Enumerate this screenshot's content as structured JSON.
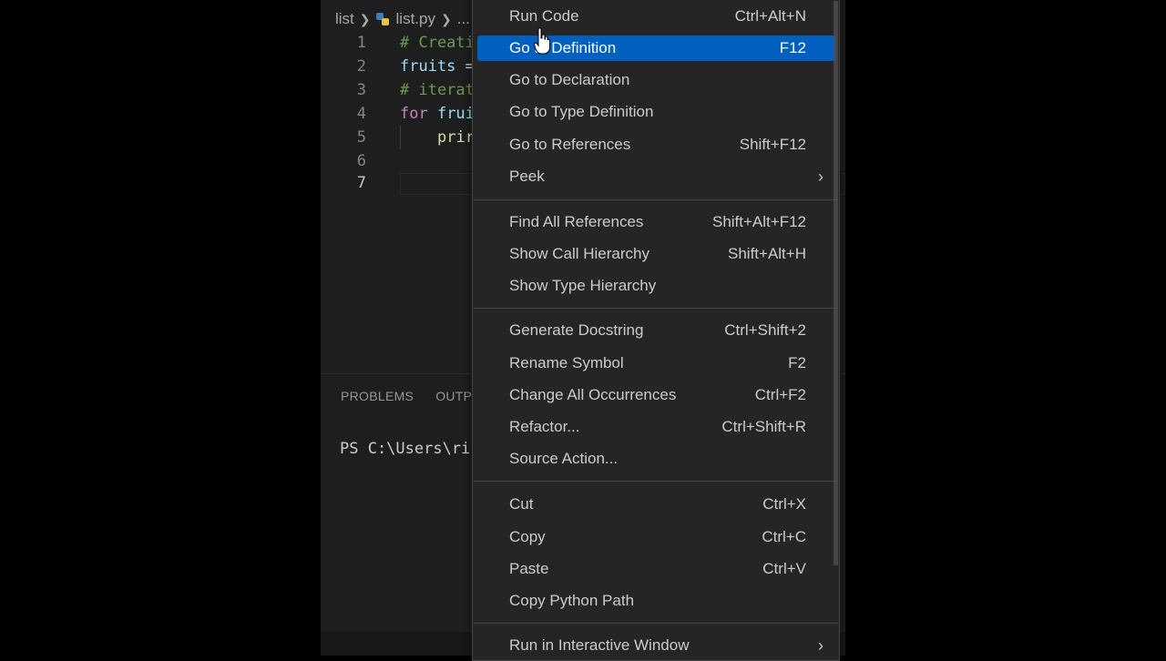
{
  "breadcrumb": {
    "folder": "list",
    "file": "list.py",
    "more": "..."
  },
  "editor": {
    "lines": [
      {
        "num": "1",
        "text": "# Creati"
      },
      {
        "num": "2",
        "a": "fruits",
        "b": " ="
      },
      {
        "num": "3",
        "text": "# iterat"
      },
      {
        "num": "4",
        "a": "for",
        "b": " frui"
      },
      {
        "num": "5",
        "text": "prir"
      },
      {
        "num": "6"
      },
      {
        "num": "7"
      }
    ]
  },
  "panel": {
    "tabs": [
      "PROBLEMS",
      "OUTPU"
    ],
    "terminal_line": "PS C:\\Users\\ri"
  },
  "context_menu": {
    "items": [
      {
        "label": "Run Code",
        "shortcut": "Ctrl+Alt+N"
      },
      {
        "label": "Go to Definition",
        "shortcut": "F12",
        "selected": true
      },
      {
        "label": "Go to Declaration",
        "shortcut": ""
      },
      {
        "label": "Go to Type Definition",
        "shortcut": ""
      },
      {
        "label": "Go to References",
        "shortcut": "Shift+F12"
      },
      {
        "label": "Peek",
        "shortcut": "",
        "submenu_glyph": "›"
      },
      {
        "label": "Find All References",
        "shortcut": "Shift+Alt+F12"
      },
      {
        "label": "Show Call Hierarchy",
        "shortcut": "Shift+Alt+H"
      },
      {
        "label": "Show Type Hierarchy",
        "shortcut": ""
      },
      {
        "label": "Generate Docstring",
        "shortcut": "Ctrl+Shift+2"
      },
      {
        "label": "Rename Symbol",
        "shortcut": "F2"
      },
      {
        "label": "Change All Occurrences",
        "shortcut": "Ctrl+F2"
      },
      {
        "label": "Refactor...",
        "shortcut": "Ctrl+Shift+R"
      },
      {
        "label": "Source Action...",
        "shortcut": ""
      },
      {
        "label": "Cut",
        "shortcut": "Ctrl+X"
      },
      {
        "label": "Copy",
        "shortcut": "Ctrl+C"
      },
      {
        "label": "Paste",
        "shortcut": "Ctrl+V"
      },
      {
        "label": "Copy Python Path",
        "shortcut": ""
      },
      {
        "label": "Run in Interactive Window",
        "shortcut": "",
        "submenu_glyph": "›"
      }
    ]
  },
  "colors": {
    "menu_selected": "#0060c0",
    "editor_bg": "#1e1e1e",
    "menu_bg": "#252526"
  }
}
